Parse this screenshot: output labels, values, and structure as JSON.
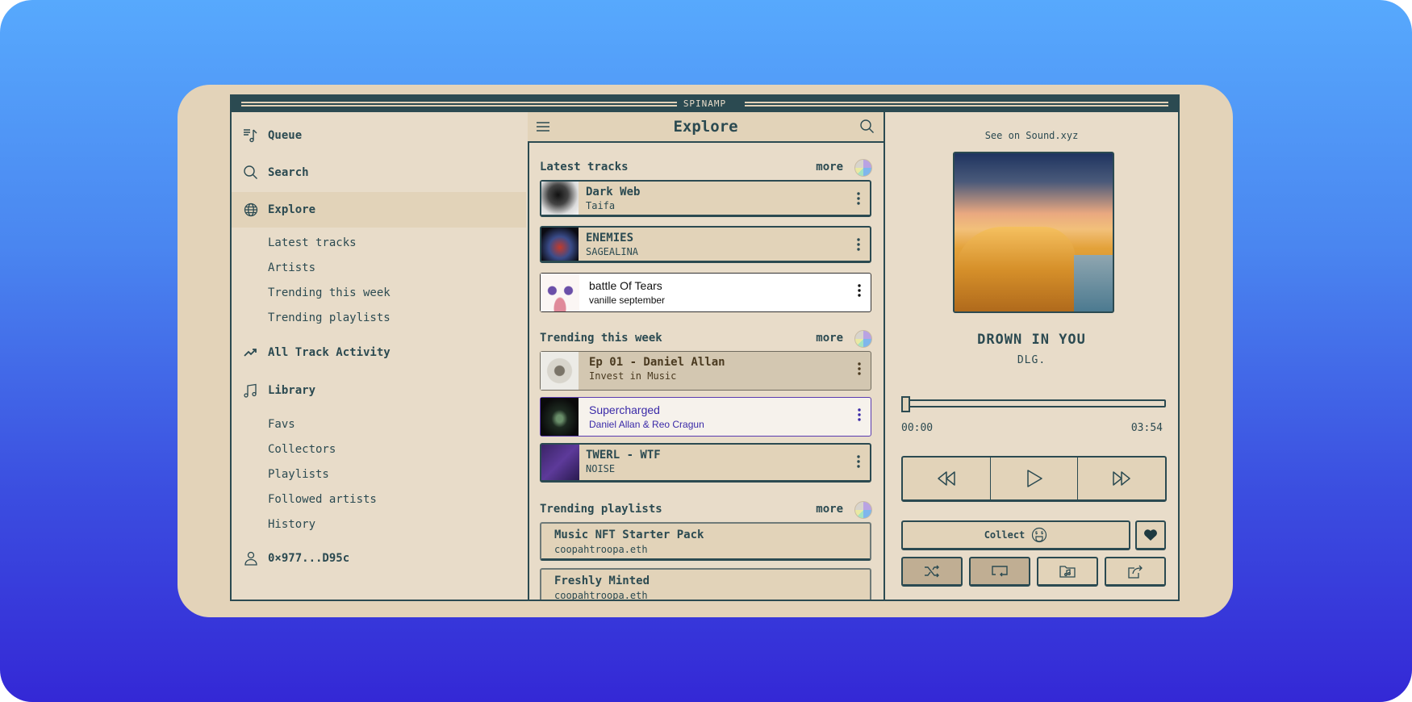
{
  "app": {
    "title": "SPINAMP"
  },
  "sidebar": {
    "items": [
      {
        "label": "Queue",
        "icon": "queue-icon"
      },
      {
        "label": "Search",
        "icon": "search-icon"
      },
      {
        "label": "Explore",
        "icon": "globe-icon",
        "active": true
      },
      {
        "label": "All Track Activity",
        "icon": "trending-icon"
      },
      {
        "label": "Library",
        "icon": "music-note-icon"
      },
      {
        "label": "0×977...D95c",
        "icon": "user-icon"
      }
    ],
    "explore_sub": [
      "Latest tracks",
      "Artists",
      "Trending this week",
      "Trending playlists"
    ],
    "library_sub": [
      "Favs",
      "Collectors",
      "Playlists",
      "Followed artists",
      "History"
    ]
  },
  "center": {
    "title": "Explore",
    "more_label": "more",
    "sections": [
      {
        "title": "Latest tracks",
        "tracks": [
          {
            "title": "Dark Web",
            "artist": "Taifa",
            "style": "default"
          },
          {
            "title": "ENEMIES",
            "artist": "SAGEALINA",
            "style": "default"
          },
          {
            "title": "battle Of Tears",
            "artist": "vanille september",
            "style": "white"
          }
        ]
      },
      {
        "title": "Trending this week",
        "tracks": [
          {
            "title": "Ep 01 - Daniel Allan",
            "artist": "Invest in Music",
            "style": "tan"
          },
          {
            "title": "Supercharged",
            "artist": "Daniel Allan & Reo Cragun",
            "style": "purple"
          },
          {
            "title": "TWERL - WTF",
            "artist": "NOISE",
            "style": "default"
          }
        ]
      },
      {
        "title": "Trending playlists",
        "playlists": [
          {
            "title": "Music NFT Starter Pack",
            "owner": "coopahtroopa.eth"
          },
          {
            "title": "Freshly Minted",
            "owner": "coopahtroopa.eth"
          }
        ]
      }
    ]
  },
  "player": {
    "see_on": "See on Sound.xyz",
    "track_title": "DROWN IN YOU",
    "track_artist": "DLG.",
    "elapsed": "00:00",
    "duration": "03:54",
    "progress_fraction": 0.0,
    "collect_label": "Collect",
    "shuffle_on": true,
    "repeat_on": true
  },
  "colors": {
    "primary": "#2b4a51",
    "panel": "#e8dcc9",
    "card": "#e2d3b9",
    "accent_purple": "#3a2aa8"
  }
}
